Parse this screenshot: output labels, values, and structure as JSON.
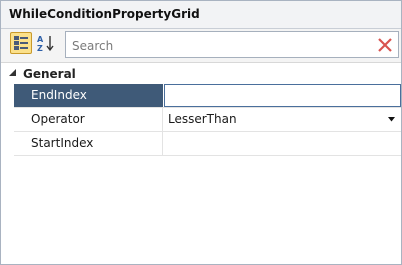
{
  "title": "WhileConditionPropertyGrid",
  "toolbar": {
    "categorized_icon": "categorized-view-icon",
    "alphabetical_icon": "sort-alphabetical-icon",
    "search_placeholder": "Search",
    "clear_icon": "clear-search-icon"
  },
  "category": {
    "label": "General",
    "expanded": true
  },
  "properties": [
    {
      "name": "EndIndex",
      "value": "",
      "selected": true
    },
    {
      "name": "Operator",
      "value": "LesserThan",
      "has_dropdown": true
    },
    {
      "name": "StartIndex",
      "value": ""
    }
  ],
  "colors": {
    "selected_row": "#3f5a78",
    "clear_icon": "#d9534f",
    "categorized_button": "#fbe08a"
  }
}
